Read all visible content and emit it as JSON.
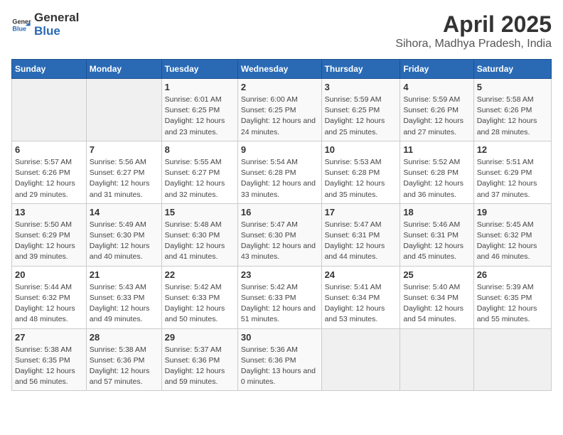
{
  "header": {
    "logo_general": "General",
    "logo_blue": "Blue",
    "title": "April 2025",
    "subtitle": "Sihora, Madhya Pradesh, India"
  },
  "weekdays": [
    "Sunday",
    "Monday",
    "Tuesday",
    "Wednesday",
    "Thursday",
    "Friday",
    "Saturday"
  ],
  "rows": [
    [
      {
        "date": "",
        "info": ""
      },
      {
        "date": "",
        "info": ""
      },
      {
        "date": "1",
        "info": "Sunrise: 6:01 AM\nSunset: 6:25 PM\nDaylight: 12 hours and 23 minutes."
      },
      {
        "date": "2",
        "info": "Sunrise: 6:00 AM\nSunset: 6:25 PM\nDaylight: 12 hours and 24 minutes."
      },
      {
        "date": "3",
        "info": "Sunrise: 5:59 AM\nSunset: 6:25 PM\nDaylight: 12 hours and 25 minutes."
      },
      {
        "date": "4",
        "info": "Sunrise: 5:59 AM\nSunset: 6:26 PM\nDaylight: 12 hours and 27 minutes."
      },
      {
        "date": "5",
        "info": "Sunrise: 5:58 AM\nSunset: 6:26 PM\nDaylight: 12 hours and 28 minutes."
      }
    ],
    [
      {
        "date": "6",
        "info": "Sunrise: 5:57 AM\nSunset: 6:26 PM\nDaylight: 12 hours and 29 minutes."
      },
      {
        "date": "7",
        "info": "Sunrise: 5:56 AM\nSunset: 6:27 PM\nDaylight: 12 hours and 31 minutes."
      },
      {
        "date": "8",
        "info": "Sunrise: 5:55 AM\nSunset: 6:27 PM\nDaylight: 12 hours and 32 minutes."
      },
      {
        "date": "9",
        "info": "Sunrise: 5:54 AM\nSunset: 6:28 PM\nDaylight: 12 hours and 33 minutes."
      },
      {
        "date": "10",
        "info": "Sunrise: 5:53 AM\nSunset: 6:28 PM\nDaylight: 12 hours and 35 minutes."
      },
      {
        "date": "11",
        "info": "Sunrise: 5:52 AM\nSunset: 6:28 PM\nDaylight: 12 hours and 36 minutes."
      },
      {
        "date": "12",
        "info": "Sunrise: 5:51 AM\nSunset: 6:29 PM\nDaylight: 12 hours and 37 minutes."
      }
    ],
    [
      {
        "date": "13",
        "info": "Sunrise: 5:50 AM\nSunset: 6:29 PM\nDaylight: 12 hours and 39 minutes."
      },
      {
        "date": "14",
        "info": "Sunrise: 5:49 AM\nSunset: 6:30 PM\nDaylight: 12 hours and 40 minutes."
      },
      {
        "date": "15",
        "info": "Sunrise: 5:48 AM\nSunset: 6:30 PM\nDaylight: 12 hours and 41 minutes."
      },
      {
        "date": "16",
        "info": "Sunrise: 5:47 AM\nSunset: 6:30 PM\nDaylight: 12 hours and 43 minutes."
      },
      {
        "date": "17",
        "info": "Sunrise: 5:47 AM\nSunset: 6:31 PM\nDaylight: 12 hours and 44 minutes."
      },
      {
        "date": "18",
        "info": "Sunrise: 5:46 AM\nSunset: 6:31 PM\nDaylight: 12 hours and 45 minutes."
      },
      {
        "date": "19",
        "info": "Sunrise: 5:45 AM\nSunset: 6:32 PM\nDaylight: 12 hours and 46 minutes."
      }
    ],
    [
      {
        "date": "20",
        "info": "Sunrise: 5:44 AM\nSunset: 6:32 PM\nDaylight: 12 hours and 48 minutes."
      },
      {
        "date": "21",
        "info": "Sunrise: 5:43 AM\nSunset: 6:33 PM\nDaylight: 12 hours and 49 minutes."
      },
      {
        "date": "22",
        "info": "Sunrise: 5:42 AM\nSunset: 6:33 PM\nDaylight: 12 hours and 50 minutes."
      },
      {
        "date": "23",
        "info": "Sunrise: 5:42 AM\nSunset: 6:33 PM\nDaylight: 12 hours and 51 minutes."
      },
      {
        "date": "24",
        "info": "Sunrise: 5:41 AM\nSunset: 6:34 PM\nDaylight: 12 hours and 53 minutes."
      },
      {
        "date": "25",
        "info": "Sunrise: 5:40 AM\nSunset: 6:34 PM\nDaylight: 12 hours and 54 minutes."
      },
      {
        "date": "26",
        "info": "Sunrise: 5:39 AM\nSunset: 6:35 PM\nDaylight: 12 hours and 55 minutes."
      }
    ],
    [
      {
        "date": "27",
        "info": "Sunrise: 5:38 AM\nSunset: 6:35 PM\nDaylight: 12 hours and 56 minutes."
      },
      {
        "date": "28",
        "info": "Sunrise: 5:38 AM\nSunset: 6:36 PM\nDaylight: 12 hours and 57 minutes."
      },
      {
        "date": "29",
        "info": "Sunrise: 5:37 AM\nSunset: 6:36 PM\nDaylight: 12 hours and 59 minutes."
      },
      {
        "date": "30",
        "info": "Sunrise: 5:36 AM\nSunset: 6:36 PM\nDaylight: 13 hours and 0 minutes."
      },
      {
        "date": "",
        "info": ""
      },
      {
        "date": "",
        "info": ""
      },
      {
        "date": "",
        "info": ""
      }
    ]
  ]
}
